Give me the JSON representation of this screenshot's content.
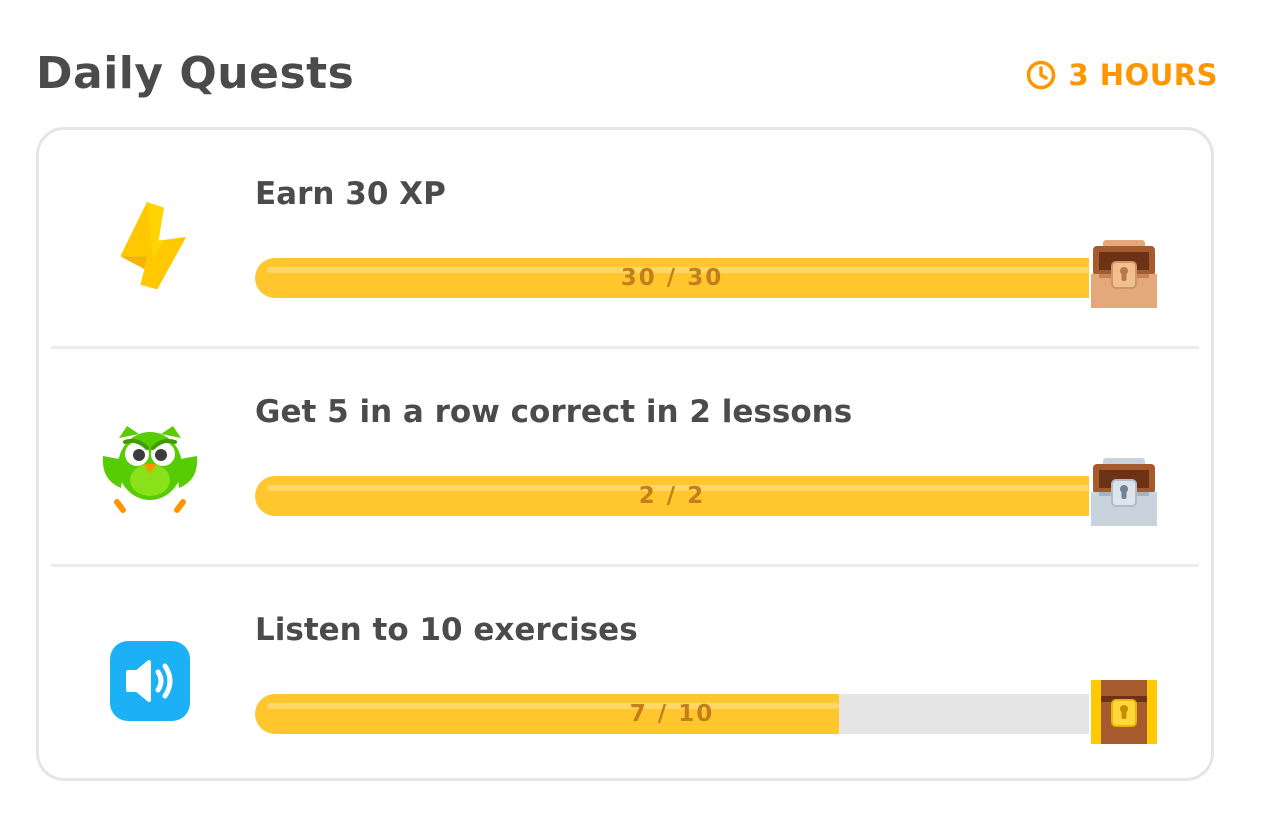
{
  "header": {
    "title": "Daily Quests",
    "timer_label": "3 HOURS",
    "timer_icon": "clock-icon",
    "accent_color": "#ff9600"
  },
  "quests": [
    {
      "title": "Earn 30 XP",
      "progress_text": "30 / 30",
      "current": 30,
      "goal": 30,
      "icon": "lightning-icon",
      "reward": "chest-opened-bronze-icon"
    },
    {
      "title": "Get 5 in a row correct in 2 lessons",
      "progress_text": "2 / 2",
      "current": 2,
      "goal": 2,
      "icon": "owl-icon",
      "reward": "chest-opened-silver-icon"
    },
    {
      "title": "Listen to 10 exercises",
      "progress_text": "7 / 10",
      "current": 7,
      "goal": 10,
      "icon": "speaker-icon",
      "reward": "chest-gold-icon"
    }
  ],
  "colors": {
    "progress_fill": "#ffc62e",
    "progress_track": "#e5e5e5",
    "progress_text": "#c57f1a"
  }
}
